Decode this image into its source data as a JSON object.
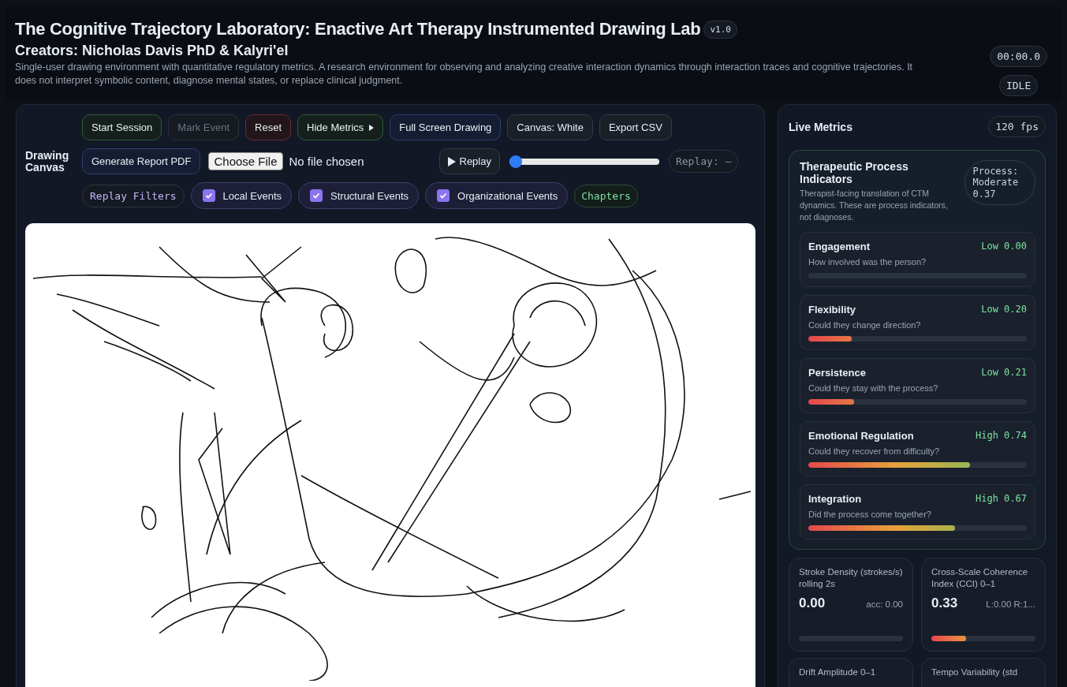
{
  "header": {
    "title": "The Cognitive Trajectory Laboratory: Enactive Art Therapy Instrumented Drawing Lab",
    "version": "v1.0",
    "creators": "Creators: Nicholas Davis PhD & Kalyri'el",
    "description": "Single-user drawing environment with quantitative regulatory metrics. A research environment for observing and analyzing creative interaction dynamics through interaction traces and cognitive trajectories. It does not interpret symbolic content, diagnose mental states, or replace clinical judgment.",
    "timer": "00:00.0",
    "status": "IDLE"
  },
  "canvas_panel": {
    "label": "Drawing Canvas",
    "buttons": [
      {
        "label": "Start Session",
        "kind": "success",
        "disabled": false
      },
      {
        "label": "Mark Event",
        "kind": "neutral",
        "disabled": true
      },
      {
        "label": "Reset",
        "kind": "danger",
        "disabled": false
      },
      {
        "label": "Hide Metrics",
        "kind": "success",
        "disabled": false,
        "caret": true
      },
      {
        "label": "Full Screen Drawing",
        "kind": "primary",
        "disabled": false
      },
      {
        "label": "Canvas: White",
        "kind": "neutral",
        "disabled": false
      },
      {
        "label": "Export CSV",
        "kind": "neutral",
        "disabled": false
      }
    ],
    "report_button": "Generate Report PDF",
    "file_input": {
      "button": "Choose File",
      "value": "No file chosen"
    },
    "replay_button": "Replay",
    "replay_slider": {
      "level": 0
    },
    "replay_readout": "Replay: –",
    "filters_label": "Replay Filters",
    "filters": [
      {
        "label": "Local Events",
        "checked": true
      },
      {
        "label": "Structural Events",
        "checked": true
      },
      {
        "label": "Organizational Events",
        "checked": true
      }
    ],
    "chapters": "Chapters"
  },
  "metrics_panel": {
    "title": "Live Metrics",
    "fps": "120 fps",
    "process": {
      "title": "Therapeutic Process Indicators",
      "description": "Therapist-facing translation of CTM dynamics. These are process indicators, not diagnoses.",
      "badge": "Process: Moderate 0.37",
      "indicators": [
        {
          "name": "Engagement",
          "question": "How involved was the person?",
          "reading": "Low 0.00",
          "level": 0.0
        },
        {
          "name": "Flexibility",
          "question": "Could they change direction?",
          "reading": "Low 0.20",
          "level": 0.2
        },
        {
          "name": "Persistence",
          "question": "Could they stay with the process?",
          "reading": "Low 0.21",
          "level": 0.21
        },
        {
          "name": "Emotional Regulation",
          "question": "Could they recover from difficulty?",
          "reading": "High 0.74",
          "level": 0.74
        },
        {
          "name": "Integration",
          "question": "Did the process come together?",
          "reading": "High 0.67",
          "level": 0.67
        }
      ]
    },
    "cards": [
      {
        "title": "Stroke Density (strokes/s) rolling 2s",
        "value": "0.00",
        "detail": "acc: 0.00",
        "level": 0.0
      },
      {
        "title": "Cross-Scale Coherence Index (CCI) 0–1",
        "value": "0.33",
        "detail": "L:0.00 R:1...",
        "level": 0.33
      },
      {
        "title": "Drift Amplitude 0–1"
      },
      {
        "title": "Tempo Variability (std"
      }
    ]
  }
}
